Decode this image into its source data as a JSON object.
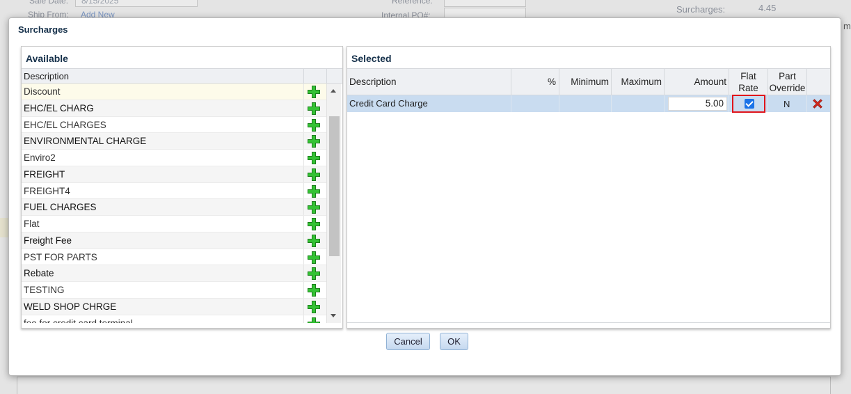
{
  "background": {
    "sale_date_label": "Sale Date:",
    "sale_date_value": "8/15/2025",
    "ship_from_label": "Ship From:",
    "ship_from_link": "Add New",
    "reference_label": "Reference:",
    "internal_po_label": "Internal PO#:",
    "surcharges_label": "Surcharges:",
    "surcharges_value": "4.45",
    "right_edge_text": "m"
  },
  "dialog": {
    "title": "Surcharges",
    "available": {
      "title": "Available",
      "column_description": "Description",
      "items": [
        "Discount",
        "EHC/EL CHARG",
        "EHC/EL CHARGES",
        "ENVIRONMENTAL CHARGE",
        "Enviro2",
        "FREIGHT",
        "FREIGHT4",
        "FUEL CHARGES",
        "Flat",
        "Freight Fee",
        "PST FOR PARTS",
        "Rebate",
        "TESTING",
        "WELD SHOP CHRGE",
        "fee for credit card terminal"
      ]
    },
    "selected": {
      "title": "Selected",
      "columns": {
        "description": "Description",
        "percent": "%",
        "minimum": "Minimum",
        "maximum": "Maximum",
        "amount": "Amount",
        "flat_rate_1": "Flat",
        "flat_rate_2": "Rate",
        "part_override_1": "Part",
        "part_override_2": "Override"
      },
      "rows": [
        {
          "description": "Credit Card Charge",
          "percent": "",
          "minimum": "",
          "maximum": "",
          "amount": "5.00",
          "flat_rate_checked": true,
          "part_override": "N"
        }
      ]
    },
    "buttons": {
      "cancel": "Cancel",
      "ok": "OK"
    }
  },
  "colors": {
    "accent": "#1a73e8",
    "highlight_border": "#e0141b",
    "selected_row": "#c9dcf0",
    "add_icon": "#2fb52f",
    "delete_icon": "#d8281c"
  }
}
